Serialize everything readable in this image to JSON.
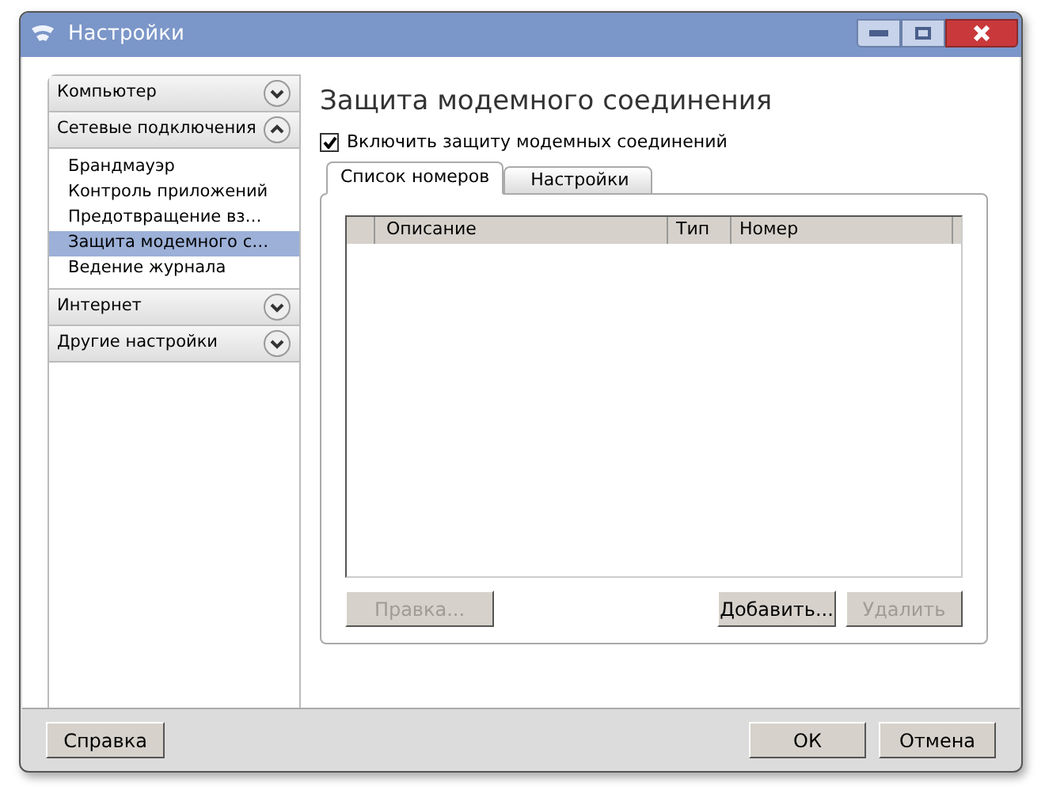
{
  "window": {
    "title": "Настройки"
  },
  "sidebar": {
    "sections": [
      {
        "label": "Компьютер",
        "expanded": false
      },
      {
        "label": "Сетевые подключения",
        "expanded": true,
        "children": [
          {
            "label": "Брандмауэр",
            "selected": false
          },
          {
            "label": "Контроль приложений",
            "selected": false
          },
          {
            "label": "Предотвращение вз…",
            "selected": false
          },
          {
            "label": "Защита модемного с…",
            "selected": true
          },
          {
            "label": "Ведение журнала",
            "selected": false
          }
        ]
      },
      {
        "label": "Интернет",
        "expanded": false
      },
      {
        "label": "Другие настройки",
        "expanded": false
      }
    ]
  },
  "content": {
    "heading": "Защита модемного соединения",
    "checkbox": {
      "label": "Включить защиту модемных соединений",
      "checked": true
    },
    "tabs": [
      {
        "label": "Список номеров",
        "selected": true
      },
      {
        "label": "Настройки",
        "selected": false
      }
    ],
    "table": {
      "columns": [
        "Описание",
        "Тип",
        "Номер"
      ]
    },
    "buttons": [
      {
        "label": "Правка...",
        "disabled": true
      },
      {
        "label": "Добавить...",
        "disabled": false
      },
      {
        "label": "Удалить",
        "disabled": true
      }
    ]
  },
  "footer": {
    "help": {
      "label": "Справка",
      "disabled": false
    },
    "buttons": [
      {
        "label": "ОК",
        "disabled": false
      },
      {
        "label": "Отмена",
        "disabled": false
      }
    ]
  }
}
